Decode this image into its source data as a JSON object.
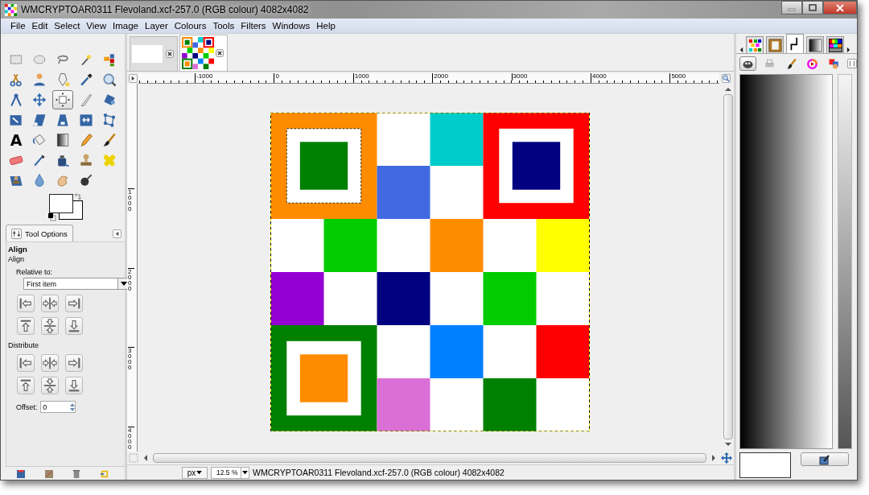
{
  "window": {
    "title": "WMCRYPTOAR0311 Flevoland.xcf-257.0 (RGB colour) 4082x4082"
  },
  "menu": [
    {
      "label": "File"
    },
    {
      "label": "Edit"
    },
    {
      "label": "Select"
    },
    {
      "label": "View"
    },
    {
      "label": "Image"
    },
    {
      "label": "Layer"
    },
    {
      "label": "Colours"
    },
    {
      "label": "Tools"
    },
    {
      "label": "Filters"
    },
    {
      "label": "Windows"
    },
    {
      "label": "Help"
    }
  ],
  "tools": [
    {
      "kind": "rect_select",
      "selected": false
    },
    {
      "kind": "ellipse_select",
      "selected": false
    },
    {
      "kind": "lasso",
      "selected": false
    },
    {
      "kind": "wand",
      "selected": false
    },
    {
      "kind": "by_colour",
      "selected": false
    },
    {
      "kind": "scissors",
      "selected": false
    },
    {
      "kind": "foreground",
      "selected": false
    },
    {
      "kind": "paths",
      "selected": false
    },
    {
      "kind": "picker",
      "selected": false
    },
    {
      "kind": "zoom",
      "selected": false
    },
    {
      "kind": "measure",
      "selected": false
    },
    {
      "kind": "move",
      "selected": false
    },
    {
      "kind": "align",
      "selected": true
    },
    {
      "kind": "crop",
      "selected": false
    },
    {
      "kind": "rotate",
      "selected": false
    },
    {
      "kind": "scale",
      "selected": false
    },
    {
      "kind": "shear",
      "selected": false
    },
    {
      "kind": "perspective",
      "selected": false
    },
    {
      "kind": "flip",
      "selected": false
    },
    {
      "kind": "cage",
      "selected": false
    },
    {
      "kind": "text",
      "label": "A",
      "selected": false
    },
    {
      "kind": "bucket",
      "selected": false
    },
    {
      "kind": "gradient",
      "selected": false
    },
    {
      "kind": "pencil",
      "selected": false
    },
    {
      "kind": "brush",
      "selected": false
    },
    {
      "kind": "eraser",
      "selected": false
    },
    {
      "kind": "airbrush",
      "selected": false
    },
    {
      "kind": "ink",
      "selected": false
    },
    {
      "kind": "clone",
      "selected": false
    },
    {
      "kind": "heal",
      "selected": false
    },
    {
      "kind": "persp_clone",
      "selected": false
    },
    {
      "kind": "blur",
      "selected": false
    },
    {
      "kind": "smudge",
      "selected": false
    },
    {
      "kind": "dodge",
      "selected": false
    }
  ],
  "image_tabs": [
    {
      "kind": "blank",
      "selected": false
    },
    {
      "kind": "board",
      "selected": true
    }
  ],
  "ruler": {
    "horizontal": [
      "-1000",
      "0",
      "1000",
      "2000",
      "3000",
      "4000",
      "5000"
    ],
    "vertical": [
      "1000",
      "2000",
      "3000",
      "4000"
    ]
  },
  "tool_options": {
    "tab": "Tool Options",
    "title": "Align",
    "section": "Align",
    "relative_label": "Relative to:",
    "relative_value": "First item",
    "align_buttons": [
      {
        "kind": "left"
      },
      {
        "kind": "hcenter"
      },
      {
        "kind": "right"
      },
      {
        "kind": "top"
      },
      {
        "kind": "vcenter"
      },
      {
        "kind": "bottom"
      }
    ],
    "distribute_label": "Distribute",
    "distribute_buttons": [
      {
        "kind": "left"
      },
      {
        "kind": "hcenter"
      },
      {
        "kind": "right"
      },
      {
        "kind": "top"
      },
      {
        "kind": "vcenter"
      },
      {
        "kind": "bottom"
      }
    ],
    "offset_label": "Offset:",
    "offset_value": "0"
  },
  "dock_tabs": [
    {
      "kind": "pattern",
      "selected": false
    },
    {
      "kind": "clipboard",
      "selected": false
    },
    {
      "kind": "bracket",
      "selected": true
    },
    {
      "kind": "gradient",
      "selected": false
    },
    {
      "kind": "palette",
      "selected": false
    }
  ],
  "dock_icons": [
    {
      "kind": "blob",
      "selected": true
    },
    {
      "kind": "printer",
      "selected": false
    },
    {
      "kind": "brush",
      "selected": false
    },
    {
      "kind": "wheel",
      "selected": false
    },
    {
      "kind": "squares",
      "selected": false
    }
  ],
  "status_bar": {
    "unit": "px",
    "zoom": "12.5 %",
    "text": "WMCRYPTOAR0311 Flevoland.xcf-257.0 (RGB colour) 4082x4082"
  }
}
